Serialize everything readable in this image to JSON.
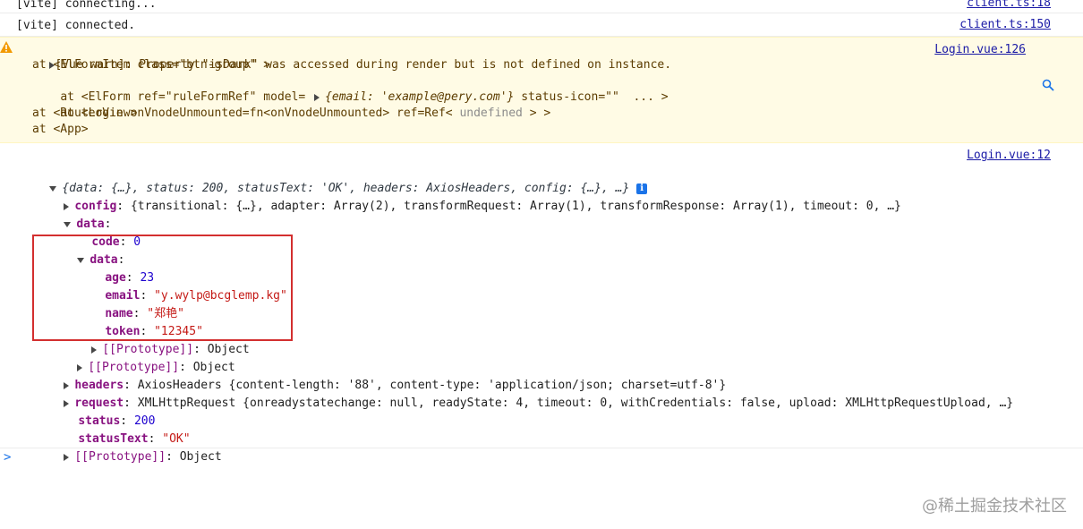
{
  "console": {
    "rows": [
      {
        "text": "[vite] connecting...",
        "source": "client.ts:18"
      },
      {
        "text": "[vite] connected.",
        "source": "client.ts:150"
      }
    ],
    "warning": {
      "source": "Login.vue:126",
      "line1": "[Vue warn]: Property \"isDark\" was accessed during render but is not defined on instance.",
      "line2": "at <ElFormItem class=\"btn-group\" >",
      "line3_prefix": "at <ElForm ref=\"ruleFormRef\" model= ",
      "line3_obj": "{email: 'example@pery.com'}",
      "line3_suffix": " status-icon=\"\"  ... >",
      "line4_prefix": "at <Login onVnodeUnmounted=fn<onVnodeUnmounted> ref=Ref< ",
      "line4_undef": "undefined",
      "line4_suffix": " > >",
      "line5": "at <RouterView>",
      "line6": "at <App>"
    },
    "log": {
      "source": "Login.vue:12",
      "summary": "{data: {…}, status: 200, statusText: 'OK', headers: AxiosHeaders, config: {…}, …}",
      "config_key": "config",
      "config_val": "{transitional: {…}, adapter: Array(2), transformRequest: Array(1), transformResponse: Array(1), timeout: 0, …}",
      "data_key": "data",
      "code_key": "code",
      "code_val": "0",
      "inner_data_key": "data",
      "age_key": "age",
      "age_val": "23",
      "email_key": "email",
      "email_val": "\"y.wylp@bcglemp.kg\"",
      "name_key": "name",
      "name_val": "\"郑艳\"",
      "token_key": "token",
      "token_val": "\"12345\"",
      "proto_key": "[[Prototype]]",
      "proto_val": "Object",
      "headers_key": "headers",
      "headers_val": "AxiosHeaders {content-length: '88', content-type: 'application/json; charset=utf-8'}",
      "request_key": "request",
      "request_val": "XMLHttpRequest {onreadystatechange: null, readyState: 4, timeout: 0, withCredentials: false, upload: XMLHttpRequestUpload, …}",
      "status_key": "status",
      "status_val": "200",
      "statusText_key": "statusText",
      "statusText_val": "\"OK\""
    },
    "prompt": ">"
  },
  "watermark": "@稀土掘金技术社区",
  "colors": {
    "warning_bg": "#fffbe5",
    "highlight": "#d32f2f",
    "link": "#1a1aa6"
  }
}
